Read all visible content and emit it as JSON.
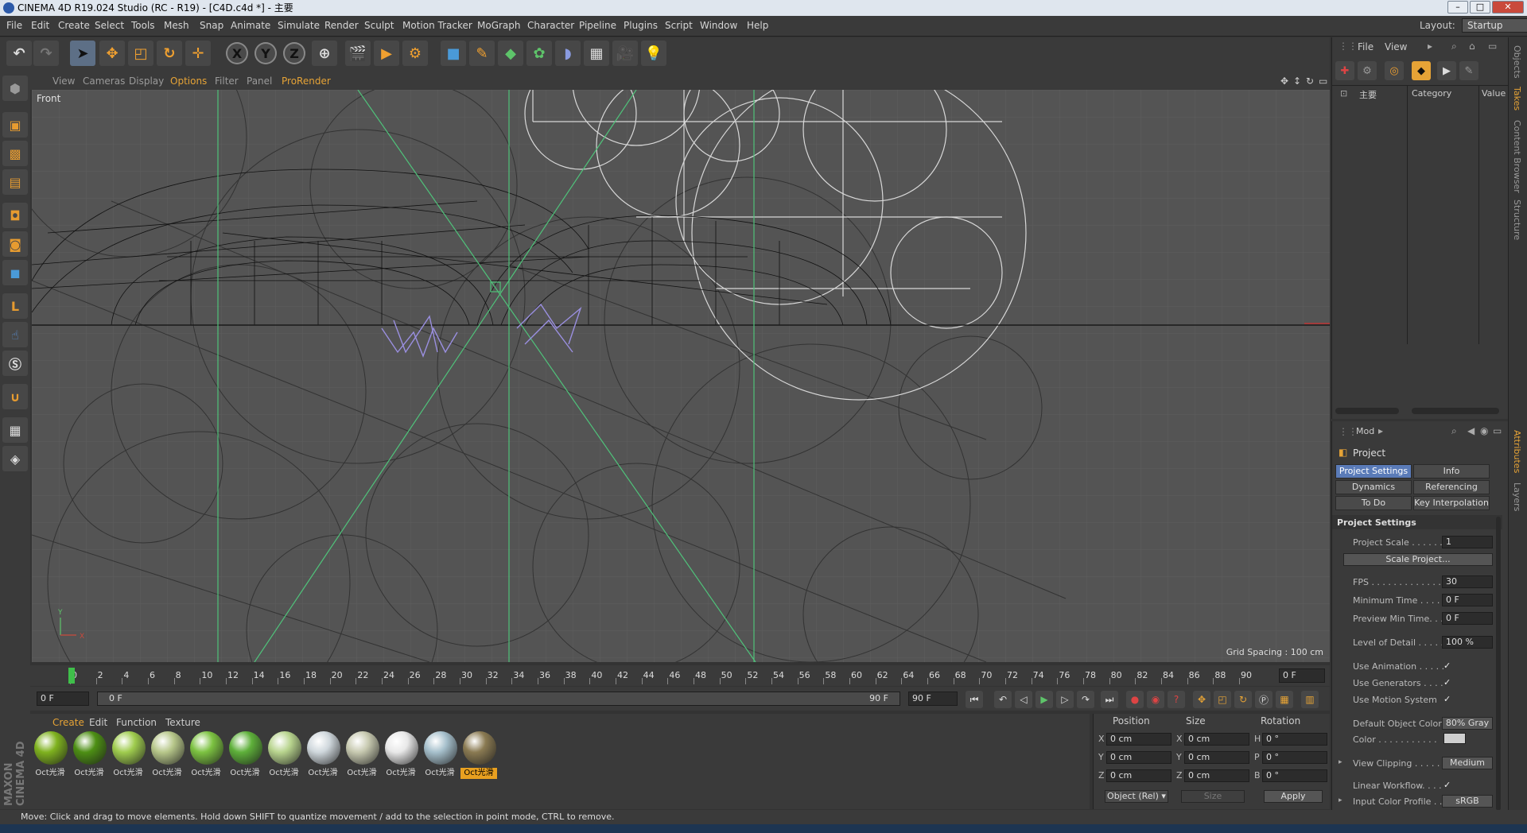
{
  "window": {
    "title": "CINEMA 4D R19.024 Studio (RC - R19) - [C4D.c4d *] - 主要",
    "buttons": [
      "–",
      "□",
      "✕"
    ]
  },
  "menu": {
    "items": [
      "File",
      "Edit",
      "Create",
      "Select",
      "Tools",
      "Mesh",
      "Snap",
      "Animate",
      "Simulate",
      "Render",
      "Sculpt",
      "Motion Tracker",
      "MoGraph",
      "Character",
      "Pipeline",
      "Plugins",
      "Script",
      "Window",
      "Help"
    ],
    "layout_label": "Layout:",
    "layout_value": "Startup"
  },
  "toolbar": {
    "undo": "↶",
    "redo": "↷",
    "axes": [
      "X",
      "Y",
      "Z"
    ]
  },
  "viewport": {
    "menu": [
      "View",
      "Cameras",
      "Display",
      "Options",
      "Filter",
      "Panel",
      "ProRender"
    ],
    "active_menu": "Options",
    "label": "Front",
    "grid_spacing": "Grid Spacing : 100 cm",
    "axis_y": "Y",
    "axis_x": "X"
  },
  "timeline": {
    "ticks": [
      "0",
      "2",
      "4",
      "6",
      "8",
      "10",
      "12",
      "14",
      "16",
      "18",
      "20",
      "22",
      "24",
      "26",
      "28",
      "30",
      "32",
      "34",
      "36",
      "38",
      "40",
      "42",
      "44",
      "46",
      "48",
      "50",
      "52",
      "54",
      "56",
      "58",
      "60",
      "62",
      "64",
      "66",
      "68",
      "70",
      "72",
      "74",
      "76",
      "78",
      "80",
      "82",
      "84",
      "86",
      "88",
      "90"
    ],
    "current_frame": "0 F",
    "start_field": "0 F",
    "slider_start": "0 F",
    "slider_end": "90 F",
    "end_field": "90 F"
  },
  "materials": {
    "menu": [
      "Create",
      "Edit",
      "Function",
      "Texture"
    ],
    "items": [
      {
        "name": "Oct光滑",
        "color": "#7fb21f"
      },
      {
        "name": "Oct光滑",
        "color": "#4d8f14"
      },
      {
        "name": "Oct光滑",
        "color": "#9fcc4e"
      },
      {
        "name": "Oct光滑",
        "color": "#b7c78a"
      },
      {
        "name": "Oct光滑",
        "color": "#7cc241"
      },
      {
        "name": "Oct光滑",
        "color": "#5eb03a"
      },
      {
        "name": "Oct光滑",
        "color": "#b8d48e"
      },
      {
        "name": "Oct光滑",
        "color": "#cfd7dc"
      },
      {
        "name": "Oct光滑",
        "color": "#c7c9b0"
      },
      {
        "name": "Oct光滑",
        "color": "#e8e8e8"
      },
      {
        "name": "Oct光滑",
        "color": "#a6c0cc"
      },
      {
        "name": "Oct光滑",
        "color": "#8a7a52"
      }
    ],
    "active_index": 11
  },
  "coords": {
    "headers": [
      "Position",
      "Size",
      "Rotation"
    ],
    "rows": [
      {
        "pl": "X",
        "pv": "0 cm",
        "sl": "X",
        "sv": "0 cm",
        "rl": "H",
        "rv": "0 °"
      },
      {
        "pl": "Y",
        "pv": "0 cm",
        "sl": "Y",
        "sv": "0 cm",
        "rl": "P",
        "rv": "0 °"
      },
      {
        "pl": "Z",
        "pv": "0 cm",
        "sl": "Z",
        "sv": "0 cm",
        "rl": "B",
        "rv": "0 °"
      }
    ],
    "mode": "Object (Rel)",
    "size_mode": "Size",
    "apply": "Apply"
  },
  "status": "Move: Click and drag to move elements. Hold down SHIFT to quantize movement / add to the selection in point mode, CTRL to remove.",
  "objects": {
    "menu": [
      "File",
      "View"
    ],
    "tree_item": "主要",
    "col_category": "Category",
    "col_value": "Value"
  },
  "attributes": {
    "mode": "Mod",
    "object": "Project",
    "tabs": [
      "Project Settings",
      "Info",
      "Dynamics",
      "Referencing",
      "To Do",
      "Key Interpolation"
    ],
    "active_tab": "Project Settings",
    "section": "Project Settings",
    "project_scale_label": "Project Scale . . . . . .",
    "project_scale": "1",
    "scale_button": "Scale Project...",
    "fps_label": "FPS . . . . . . . . . . . . . .",
    "fps": "30",
    "min_time_label": "Minimum Time . . . .",
    "min_time": "0 F",
    "preview_min_label": "Preview Min Time. . .",
    "preview_min": "0 F",
    "lod_label": "Level of Detail . . . . .",
    "lod": "100 %",
    "use_anim": "Use Animation . . . . .",
    "use_gen": "Use Generators . . . .",
    "use_motion": "Use Motion System",
    "def_color_label": "Default Object Color",
    "def_color": "80% Gray",
    "color_label": "Color . . . . . . . . . . .",
    "view_clip_label": "View Clipping . . . . . .",
    "view_clip": "Medium",
    "linear_label": "Linear Workflow. . . .",
    "icp_label": "Input Color Profile . .",
    "icp": "sRGB",
    "check": "✓"
  },
  "side_tabs": [
    "Objects",
    "Takes",
    "Content Browser",
    "Structure",
    "Attributes",
    "Layers"
  ],
  "colors": {
    "accent": "#e6a336",
    "guide_green": "#4fc27a",
    "wire": "#111111",
    "selected_blue": "#5a7bb8"
  }
}
